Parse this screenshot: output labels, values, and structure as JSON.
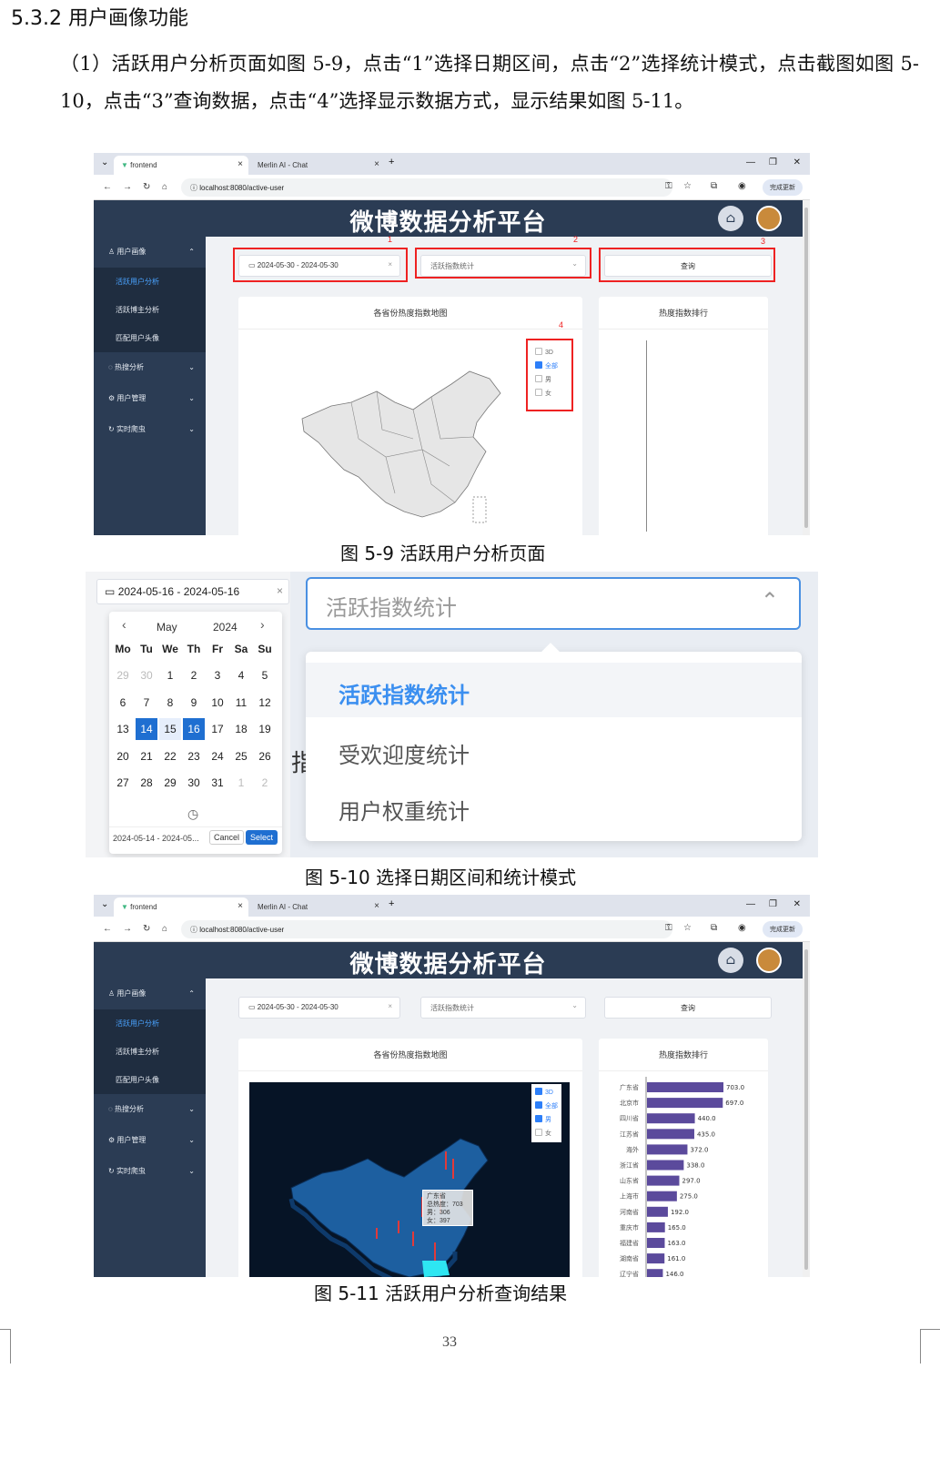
{
  "heading": "5.3.2 用户画像功能",
  "paragraph": "（1）活跃用户分析页面如图 5-9，点击“1”选择日期区间，点击“2”选择统计模式，点击截图如图 5-10，点击“3”查询数据，点击“4”选择显示数据方式，显示结果如图 5-11。",
  "browser": {
    "tab1": "frontend",
    "tab2": "Merlin AI - Chat",
    "url": "localhost:8080/active-user",
    "update_label": "完成更新"
  },
  "app": {
    "title": "微博数据分析平台",
    "sidebar": {
      "user_profile": "用户画像",
      "active_user": "活跃用户分析",
      "active_blogger": "活跃博主分析",
      "match_avatar": "匹配用户头像",
      "hot_search": "热搜分析",
      "user_mgmt": "用户管理",
      "crawler": "实时爬虫"
    },
    "date_range": "2024-05-30 - 2024-05-30",
    "mode_placeholder": "活跃指数统计",
    "query_label": "查询",
    "map_title": "各省份热度指数地图",
    "rank_title": "热度指数排行",
    "legend": [
      "3D",
      "全部",
      "男",
      "女"
    ],
    "markers": [
      "1",
      "2",
      "3",
      "4"
    ]
  },
  "fig5_10": {
    "date_range": "2024-05-16 - 2024-05-16",
    "month": "May",
    "year": "2024",
    "weekdays": [
      "Mo",
      "Tu",
      "We",
      "Th",
      "Fr",
      "Sa",
      "Su"
    ],
    "weeks": [
      [
        "29",
        "30",
        "1",
        "2",
        "3",
        "4",
        "5"
      ],
      [
        "6",
        "7",
        "8",
        "9",
        "10",
        "11",
        "12"
      ],
      [
        "13",
        "14",
        "15",
        "16",
        "17",
        "18",
        "19"
      ],
      [
        "20",
        "21",
        "22",
        "23",
        "24",
        "25",
        "26"
      ],
      [
        "27",
        "28",
        "29",
        "30",
        "31",
        "1",
        "2"
      ]
    ],
    "footer_range": "2024-05-14 - 2024-05...",
    "cancel": "Cancel",
    "select": "Select",
    "select_value": "活跃指数统计",
    "options": [
      "活跃指数统计",
      "受欢迎度统计",
      "用户权重统计"
    ],
    "partial_char": "指"
  },
  "fig5_11": {
    "tooltip": {
      "name": "广东省",
      "total": "总热度：703",
      "male": "男：306",
      "female": "女：397"
    }
  },
  "chart_data": {
    "type": "bar",
    "title": "热度指数排行",
    "categories": [
      "广东省",
      "北京市",
      "四川省",
      "江苏省",
      "海外",
      "浙江省",
      "山东省",
      "上海市",
      "河南省",
      "重庆市",
      "福建省",
      "湖南省",
      "辽宁省"
    ],
    "values": [
      703.0,
      697.0,
      440.0,
      435.0,
      372.0,
      338.0,
      297.0,
      275.0,
      192.0,
      165.0,
      163.0,
      161.0,
      146.0
    ],
    "color": "#5b4a9c"
  },
  "captions": {
    "fig5_9": "图 5-9 活跃用户分析页面",
    "fig5_10": "图 5-10 选择日期区间和统计模式",
    "fig5_11": "图 5-11 活跃用户分析查询结果"
  },
  "page_number": "33"
}
